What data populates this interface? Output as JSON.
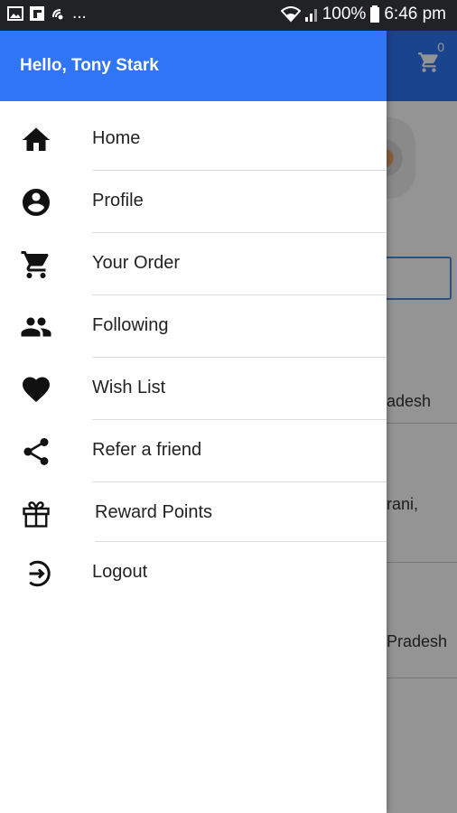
{
  "status_bar": {
    "overflow": "...",
    "battery": "100%",
    "time": "6:46 pm"
  },
  "app_behind": {
    "cart_count": "0",
    "line1": "adesh",
    "line2": "rani,",
    "line3": "Pradesh"
  },
  "drawer": {
    "greeting": "Hello, Tony Stark",
    "items": [
      {
        "label": "Home",
        "icon": "home-icon"
      },
      {
        "label": "Profile",
        "icon": "account-circle-icon"
      },
      {
        "label": "Your Order",
        "icon": "cart-icon"
      },
      {
        "label": "Following",
        "icon": "people-icon"
      },
      {
        "label": "Wish List",
        "icon": "heart-icon"
      },
      {
        "label": "Refer a friend",
        "icon": "share-icon"
      },
      {
        "label": "Reward Points",
        "icon": "gift-icon"
      },
      {
        "label": "Logout",
        "icon": "logout-icon"
      }
    ]
  },
  "colors": {
    "primary": "#2f75f5",
    "status_bar": "#202226",
    "scrim": "#6b6b6b"
  }
}
